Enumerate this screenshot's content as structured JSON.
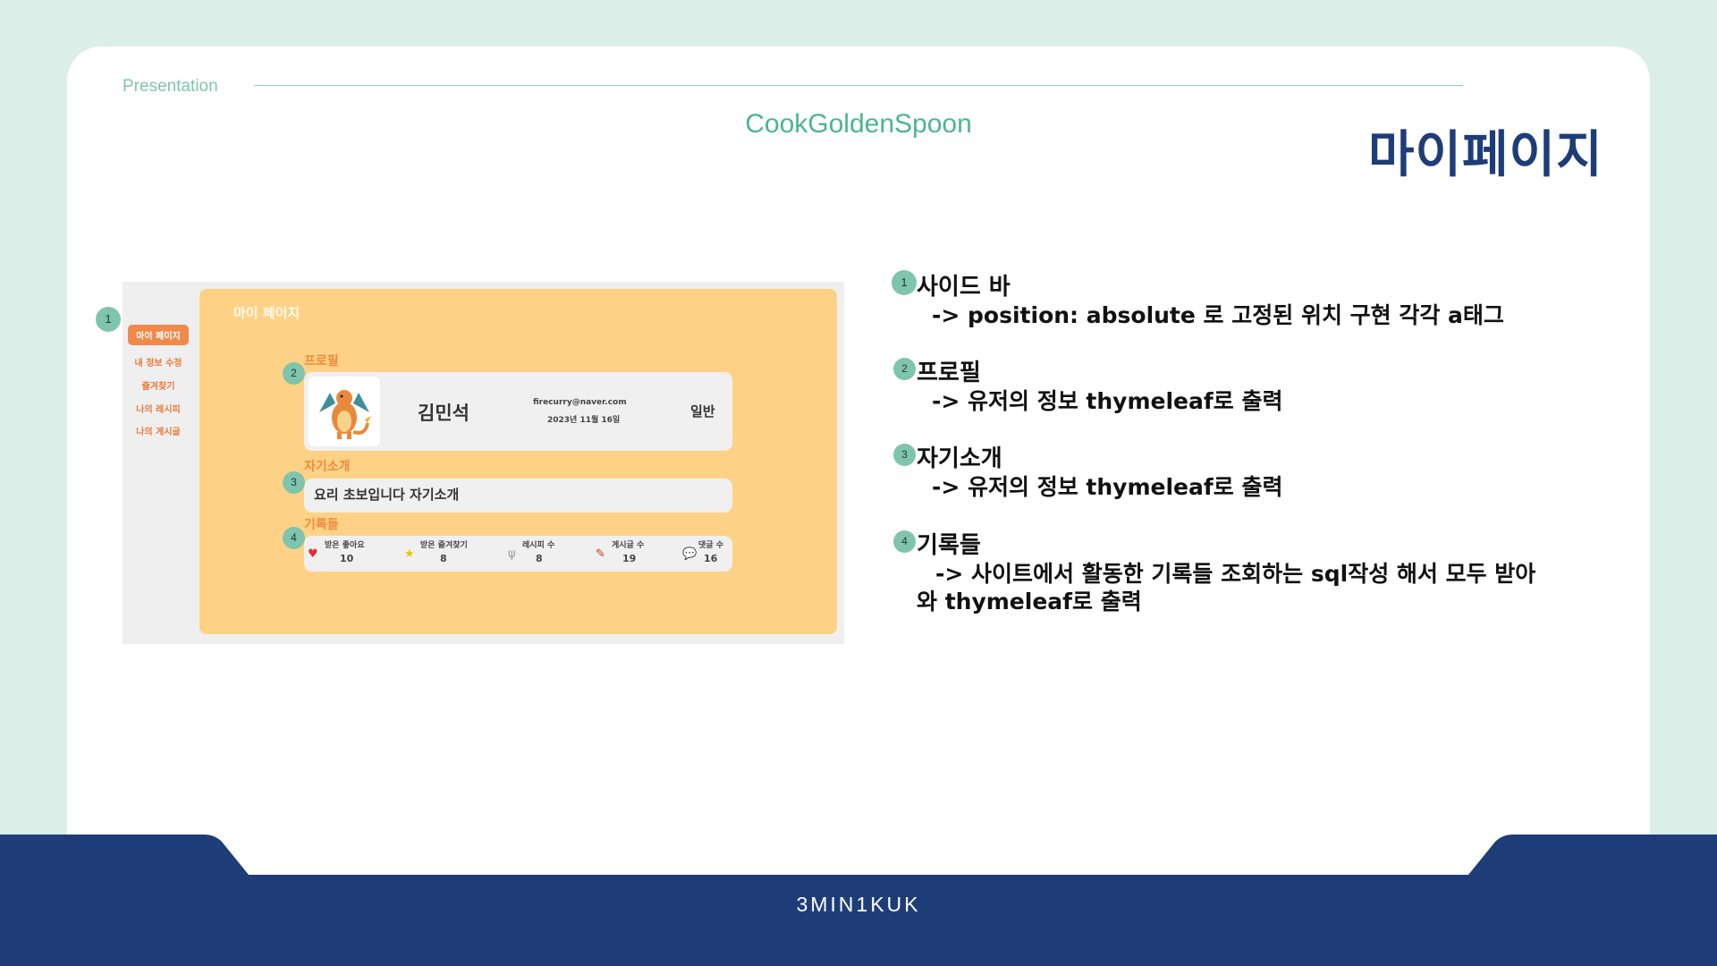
{
  "header": {
    "section_label": "Presentation",
    "brand": "CookGoldenSpoon",
    "page_title": "마이페이지"
  },
  "screenshot": {
    "sidebar": {
      "items": [
        "마이 페이지",
        "내 정보 수정",
        "즐겨찾기",
        "나의 레시피",
        "나의 게시글"
      ],
      "active_index": 0
    },
    "main_title": "마이 페이지",
    "profile": {
      "section_label": "프로필",
      "name": "김민석",
      "email": "firecurry@naver.com",
      "joined": "2023년 11월 16일",
      "role": "일반",
      "avatar_icon": "dragon-avatar"
    },
    "intro": {
      "section_label": "자기소개",
      "text": "요리 초보입니다 자기소개"
    },
    "records": {
      "section_label": "기록들",
      "stats": [
        {
          "label": "받은 좋아요",
          "value": "10",
          "icon": "heart-icon",
          "color": "#e0303a"
        },
        {
          "label": "받은 즐겨찾기",
          "value": "8",
          "icon": "star-icon",
          "color": "#f2c400"
        },
        {
          "label": "레시피 수",
          "value": "8",
          "icon": "utensils-icon",
          "color": "#999999"
        },
        {
          "label": "게시글 수",
          "value": "19",
          "icon": "pencil-icon",
          "color": "#c0392b"
        },
        {
          "label": "댓글 수",
          "value": "16",
          "icon": "comment-icon",
          "color": "#444444"
        }
      ]
    },
    "badges": [
      "1",
      "2",
      "3",
      "4"
    ]
  },
  "descriptions": [
    {
      "num": "1",
      "title": "사이드 바",
      "lines": [
        "-> position: absolute 로 고정된 위치 구현 각각 a태그"
      ]
    },
    {
      "num": "2",
      "title": "프로필",
      "lines": [
        "-> 유저의 정보 thymeleaf로 출력"
      ]
    },
    {
      "num": "3",
      "title": "자기소개",
      "lines": [
        "-> 유저의 정보 thymeleaf로 출력"
      ]
    },
    {
      "num": "4",
      "title": "기록들",
      "lines": [
        "-> 사이트에서 활동한 기록들 조회하는 sql작성 해서 모두 받아",
        "와 thymeleaf로 출력"
      ]
    }
  ],
  "footer": {
    "text": "3MIN1KUK"
  },
  "colors": {
    "accent": "#7fc4ad",
    "brand": "#4cb590",
    "navy": "#1e3d78",
    "orange": "#f08a4b",
    "panel_bg": "#fdd286"
  }
}
